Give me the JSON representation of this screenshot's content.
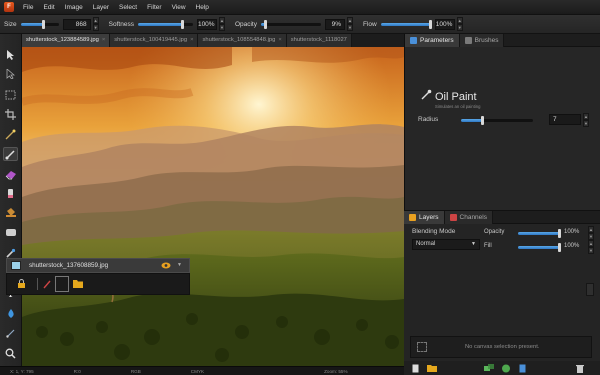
{
  "menu": {
    "logo": "F",
    "items": [
      "File",
      "Edit",
      "Image",
      "Layer",
      "Select",
      "Filter",
      "View",
      "Help"
    ]
  },
  "options": {
    "size_label": "Size",
    "size_value": "868",
    "softness_label": "Softness",
    "softness_value": "100%",
    "opacity_label": "Opacity",
    "opacity_value": "9%",
    "flow_label": "Flow",
    "flow_value": "100%",
    "size_level": 0.62,
    "softness_level": 0.82,
    "opacity_level": 0.09,
    "flow_level": 1.0
  },
  "tabs": [
    {
      "label": "shutterstock_123884589.jpg",
      "close": "×"
    },
    {
      "label": "shutterstock_100419445.jpg",
      "close": "×"
    },
    {
      "label": "shutterstock_108554848.jpg",
      "close": "×"
    },
    {
      "label": "shutterstock_1118027",
      "close": ""
    }
  ],
  "status": {
    "coords": "X: 1, Y: 795",
    "rgb_label": "R:0",
    "mode": "RGB",
    "cmyk": "CMYK",
    "zoom": "Zoom: 55%"
  },
  "panel": {
    "tabs": [
      {
        "label": "Parameters",
        "color": "#4a90d9"
      },
      {
        "label": "Brushes",
        "color": "#7a7a7a"
      }
    ],
    "filter_title": "Oil Paint",
    "filter_subtitle": "Simulates an oil painting",
    "radius_label": "Radius",
    "radius_value": "7",
    "radius_level": 0.3
  },
  "layers": {
    "tabs": [
      {
        "label": "Layers",
        "color": "#e8a020"
      },
      {
        "label": "Channels",
        "color": "#c44"
      }
    ],
    "blending_label": "Blending Mode",
    "blending_value": "Normal",
    "opacity_label": "Opacity",
    "opacity_value": "100%",
    "opacity_level": 1.0,
    "fill_label": "Fill",
    "fill_value": "100%",
    "fill_level": 1.0,
    "layer_name": "shutterstock_137608859.jpg",
    "selection_status": "No canvas selection present."
  },
  "colors": {
    "accent": "#4a90d9",
    "logo": "#d9481a",
    "folder": "#e5a81d"
  }
}
